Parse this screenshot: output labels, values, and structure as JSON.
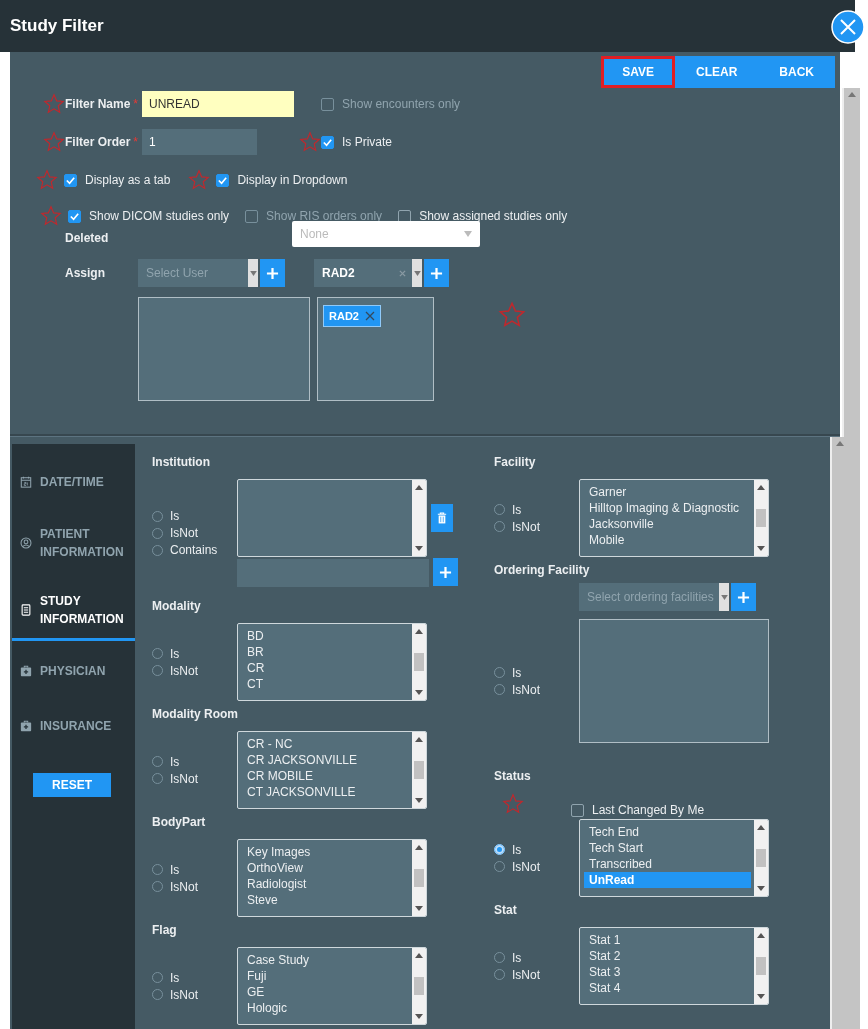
{
  "window": {
    "title": "Study Filter"
  },
  "actions": [
    {
      "label": "SAVE",
      "highlighted": true
    },
    {
      "label": "CLEAR",
      "highlighted": false
    },
    {
      "label": "BACK",
      "highlighted": false
    }
  ],
  "filter_name": {
    "label": "Filter Name",
    "required_mark": "*",
    "value": "UNREAD",
    "starred": true
  },
  "show_encounters_only": {
    "label": "Show encounters only",
    "checked": false,
    "disabled": true
  },
  "filter_order": {
    "label": "Filter Order",
    "required_mark": "*",
    "value": "1",
    "starred": true
  },
  "is_private": {
    "label": "Is Private",
    "checked": true,
    "starred": true
  },
  "display_options": [
    {
      "label": "Display as a tab",
      "checked": true,
      "starred": true
    },
    {
      "label": "Display in Dropdown",
      "checked": true,
      "starred": true
    }
  ],
  "study_options": [
    {
      "label": "Show DICOM studies only",
      "checked": true,
      "disabled": false,
      "starred": true
    },
    {
      "label": "Show RIS orders only",
      "checked": false,
      "disabled": true,
      "starred": false
    },
    {
      "label": "Show assigned studies only",
      "checked": false,
      "disabled": false,
      "starred": false
    }
  ],
  "deleted": {
    "label": "Deleted",
    "placeholder": "None"
  },
  "assign": {
    "label": "Assign",
    "user_placeholder": "Select User",
    "group_value": "RAD2",
    "group_tags": [
      "RAD2"
    ],
    "starred": true
  },
  "sidebar": {
    "items": [
      {
        "label": "DATE/TIME",
        "selected": false
      },
      {
        "label": "PATIENT INFORMATION",
        "selected": false
      },
      {
        "label": "STUDY INFORMATION",
        "selected": true
      },
      {
        "label": "PHYSICIAN",
        "selected": false
      },
      {
        "label": "INSURANCE",
        "selected": false
      }
    ],
    "reset_label": "RESET"
  },
  "criteria": {
    "left": [
      {
        "title": "Institution",
        "kind": "listbox",
        "options": [
          {
            "label": "Is",
            "selected": false
          },
          {
            "label": "IsNot",
            "selected": false
          },
          {
            "label": "Contains",
            "selected": false
          }
        ],
        "trash_button": true,
        "text_input": true
      },
      {
        "title": "Modality",
        "kind": "listbox",
        "options": [
          {
            "label": "Is",
            "selected": false
          },
          {
            "label": "IsNot",
            "selected": false
          }
        ],
        "items": [
          {
            "label": "BD",
            "selected": false
          },
          {
            "label": "BR",
            "selected": false
          },
          {
            "label": "CR",
            "selected": false
          },
          {
            "label": "CT",
            "selected": false
          }
        ]
      },
      {
        "title": "Modality Room",
        "kind": "listbox",
        "options": [
          {
            "label": "Is",
            "selected": false
          },
          {
            "label": "IsNot",
            "selected": false
          }
        ],
        "items": [
          {
            "label": "CR - NC",
            "selected": false
          },
          {
            "label": "CR JACKSONVILLE",
            "selected": false
          },
          {
            "label": "CR MOBILE",
            "selected": false
          },
          {
            "label": "CT JACKSONVILLE",
            "selected": false
          }
        ]
      },
      {
        "title": "BodyPart",
        "kind": "listbox",
        "options": [
          {
            "label": "Is",
            "selected": false
          },
          {
            "label": "IsNot",
            "selected": false
          }
        ],
        "items": [
          {
            "label": "Key Images",
            "selected": false
          },
          {
            "label": "OrthoView",
            "selected": false
          },
          {
            "label": "Radiologist",
            "selected": false
          },
          {
            "label": "Steve",
            "selected": false
          }
        ]
      },
      {
        "title": "Flag",
        "kind": "listbox",
        "options": [
          {
            "label": "Is",
            "selected": false
          },
          {
            "label": "IsNot",
            "selected": false
          }
        ],
        "items": [
          {
            "label": "Case Study",
            "selected": false
          },
          {
            "label": "Fuji",
            "selected": false
          },
          {
            "label": "GE",
            "selected": false
          },
          {
            "label": "Hologic",
            "selected": false
          }
        ]
      }
    ],
    "right": [
      {
        "title": "Facility",
        "kind": "listbox",
        "options": [
          {
            "label": "Is",
            "selected": false
          },
          {
            "label": "IsNot",
            "selected": false
          }
        ],
        "items": [
          {
            "label": "Garner",
            "selected": false
          },
          {
            "label": "Hilltop Imaging & Diagnostic",
            "selected": false
          },
          {
            "label": "Jacksonville",
            "selected": false
          },
          {
            "label": "Mobile",
            "selected": false
          }
        ]
      },
      {
        "title": "Ordering Facility",
        "kind": "plain",
        "options": [
          {
            "label": "Is",
            "selected": false
          },
          {
            "label": "IsNot",
            "selected": false
          }
        ],
        "select_placeholder": "Select ordering facilities"
      },
      {
        "title": "Status",
        "kind": "listbox",
        "starred": true,
        "checkbox": {
          "label": "Last Changed By Me",
          "checked": false
        },
        "options": [
          {
            "label": "Is",
            "selected": true
          },
          {
            "label": "IsNot",
            "selected": false
          }
        ],
        "items": [
          {
            "label": "Tech End",
            "selected": false
          },
          {
            "label": "Tech Start",
            "selected": false
          },
          {
            "label": "Transcribed",
            "selected": false
          },
          {
            "label": "UnRead",
            "selected": true
          }
        ]
      },
      {
        "title": "Stat",
        "kind": "listbox",
        "options": [
          {
            "label": "Is",
            "selected": false
          },
          {
            "label": "IsNot",
            "selected": false
          }
        ],
        "items": [
          {
            "label": "Stat 1",
            "selected": false
          },
          {
            "label": "Stat 2",
            "selected": false
          },
          {
            "label": "Stat 3",
            "selected": false
          },
          {
            "label": "Stat 4",
            "selected": false
          }
        ]
      }
    ]
  }
}
